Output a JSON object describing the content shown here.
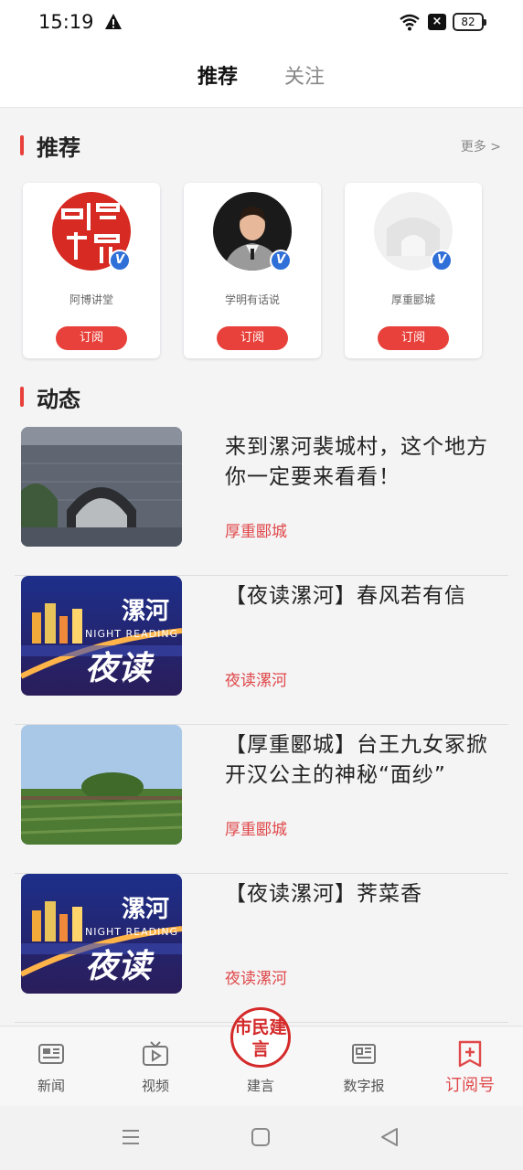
{
  "status_bar": {
    "time": "15:19",
    "battery": "82",
    "icons": [
      "warning-icon",
      "wifi-icon",
      "sim-x-icon",
      "battery-icon"
    ]
  },
  "top_tabs": {
    "active": "推荐",
    "items": [
      "推荐",
      "关注"
    ]
  },
  "recommend": {
    "title": "推荐",
    "more": "更多 >",
    "cards": [
      {
        "name": "阿博讲堂",
        "button": "订阅",
        "verified": "V"
      },
      {
        "name": "学明有话说",
        "button": "订阅",
        "verified": "V"
      },
      {
        "name": "厚重郾城",
        "button": "订阅",
        "verified": "V"
      }
    ]
  },
  "feed": {
    "title": "动态",
    "items": [
      {
        "title": "来到漯河裴城村，这个地方你一定要来看看！",
        "source": "厚重郾城"
      },
      {
        "title": "【夜读漯河】春风若有信",
        "source": "夜读漯河",
        "thumb_text": [
          "漯河",
          "NIGHT READING",
          "夜读"
        ]
      },
      {
        "title": "【厚重郾城】台王九女冢掀开汉公主的神秘“面纱”",
        "source": "厚重郾城"
      },
      {
        "title": "【夜读漯河】荠菜香",
        "source": "夜读漯河",
        "thumb_text": [
          "漯河",
          "NIGHT READING",
          "夜读"
        ]
      }
    ]
  },
  "bottom_nav": {
    "items": [
      {
        "label": "新闻",
        "icon": "newspaper-icon"
      },
      {
        "label": "视频",
        "icon": "tv-play-icon"
      },
      {
        "label": "建言",
        "icon": "seal-logo"
      },
      {
        "label": "数字报",
        "icon": "digital-paper-icon"
      },
      {
        "label": "订阅号",
        "icon": "subscribe-bookmark-icon"
      }
    ],
    "active": "订阅号",
    "seal_text": "市民建言"
  },
  "colors": {
    "accent": "#e8403a",
    "verified": "#2f6fd8"
  }
}
